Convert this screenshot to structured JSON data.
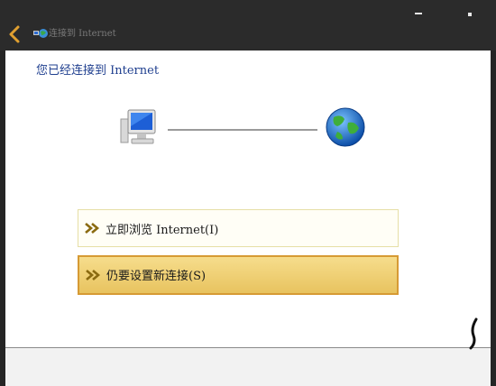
{
  "window": {
    "title": "连接到 Internet",
    "minimize_glyph": "—",
    "close_glyph": "x"
  },
  "main": {
    "heading": "您已经连接到 Internet"
  },
  "options": [
    {
      "label": "立即浏览 Internet(I)"
    },
    {
      "label": "仍要设置新连接(S)"
    }
  ],
  "colors": {
    "heading": "#1f3f8f",
    "highlight_fill": "#f2d47a",
    "highlight_border": "#d69a34",
    "chevron": "#8a6a10"
  },
  "icons": {
    "back": "back-arrow-icon",
    "network": "network-icon",
    "computer": "computer-icon",
    "globe": "globe-icon",
    "chevron": "double-chevron-right-icon"
  }
}
